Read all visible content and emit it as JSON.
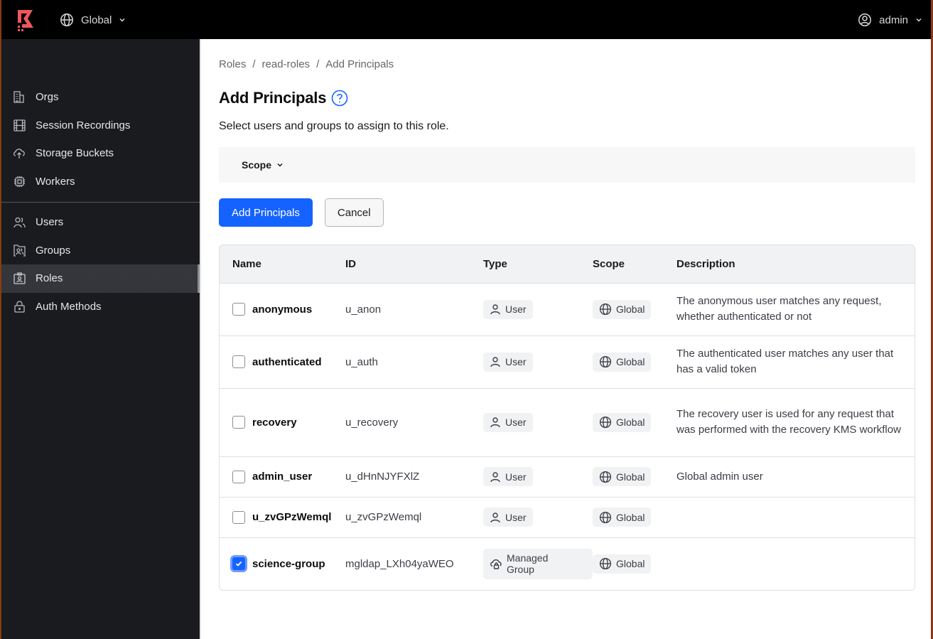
{
  "topbar": {
    "logo": "boundary-logo",
    "scope_label": "Global",
    "user_label": "admin",
    "brand_color": "#ec585d"
  },
  "sidebar": {
    "groups": [
      [
        {
          "label": "Orgs",
          "icon": "org-icon"
        },
        {
          "label": "Session Recordings",
          "icon": "film-icon"
        },
        {
          "label": "Storage Buckets",
          "icon": "cloud-upload-icon"
        },
        {
          "label": "Workers",
          "icon": "cpu-icon"
        }
      ],
      [
        {
          "label": "Users",
          "icon": "users-icon"
        },
        {
          "label": "Groups",
          "icon": "folder-users-icon"
        },
        {
          "label": "Roles",
          "icon": "id-card-icon",
          "active": true
        },
        {
          "label": "Auth Methods",
          "icon": "lock-icon"
        }
      ]
    ]
  },
  "breadcrumb": [
    "Roles",
    "read-roles",
    "Add Principals"
  ],
  "page": {
    "title": "Add Principals",
    "subtitle": "Select users and groups to assign to this role.",
    "filter_label": "Scope",
    "primary_button": "Add Principals",
    "cancel_button": "Cancel",
    "accent_color": "#1563ff"
  },
  "table": {
    "headers": [
      "Name",
      "ID",
      "Type",
      "Scope",
      "Description"
    ],
    "rows": [
      {
        "name": "anonymous",
        "id": "u_anon",
        "type": "User",
        "scope": "Global",
        "description": "The anonymous user matches any request, whether authenticated or not",
        "checked": false
      },
      {
        "name": "authenticated",
        "id": "u_auth",
        "type": "User",
        "scope": "Global",
        "description": "The authenticated user matches any user that has a valid token",
        "checked": false
      },
      {
        "name": "recovery",
        "id": "u_recovery",
        "type": "User",
        "scope": "Global",
        "description": "The recovery user is used for any request that was performed with the recovery KMS workflow",
        "checked": false
      },
      {
        "name": "admin_user",
        "id": "u_dHnNJYFXlZ",
        "type": "User",
        "scope": "Global",
        "description": "Global admin user",
        "checked": false
      },
      {
        "name": "u_zvGPzWemql",
        "id": "u_zvGPzWemql",
        "type": "User",
        "scope": "Global",
        "description": "",
        "checked": false
      },
      {
        "name": "science-group",
        "id": "mgldap_LXh04yaWEO",
        "type": "Managed Group",
        "scope": "Global",
        "description": "",
        "checked": true
      }
    ]
  }
}
